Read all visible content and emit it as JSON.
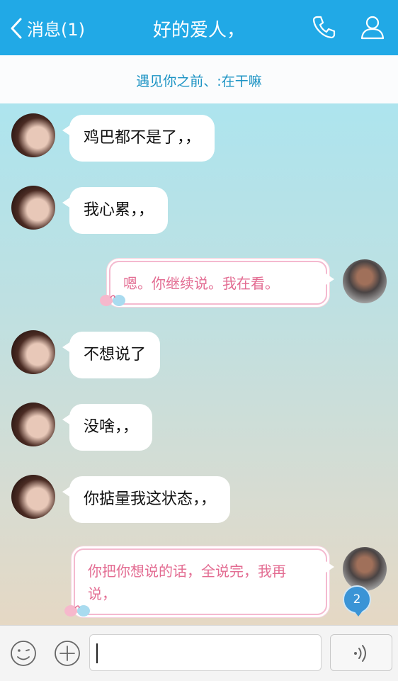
{
  "header": {
    "back_label": "消息(1)",
    "title": "好的爱人，",
    "icons": [
      "chevron-left-icon",
      "phone-icon",
      "profile-icon"
    ],
    "bg_color": "#21a9e6"
  },
  "status": {
    "text": "遇见你之前、:在干嘛"
  },
  "messages": [
    {
      "side": "left",
      "text": "鸡巴都不是了，，"
    },
    {
      "side": "left",
      "text": "我心累，，"
    },
    {
      "side": "right",
      "text": "嗯。你继续说。我在看。"
    },
    {
      "side": "left",
      "text": "不想说了"
    },
    {
      "side": "left",
      "text": "没啥，，"
    },
    {
      "side": "left",
      "text": "你掂量我这状态，，"
    },
    {
      "side": "right",
      "text": "你把你想说的话，全说完，我再说，",
      "badge": "2"
    }
  ],
  "input": {
    "value": "",
    "icons": [
      "emoji-icon",
      "plus-icon",
      "voice-icon"
    ]
  }
}
